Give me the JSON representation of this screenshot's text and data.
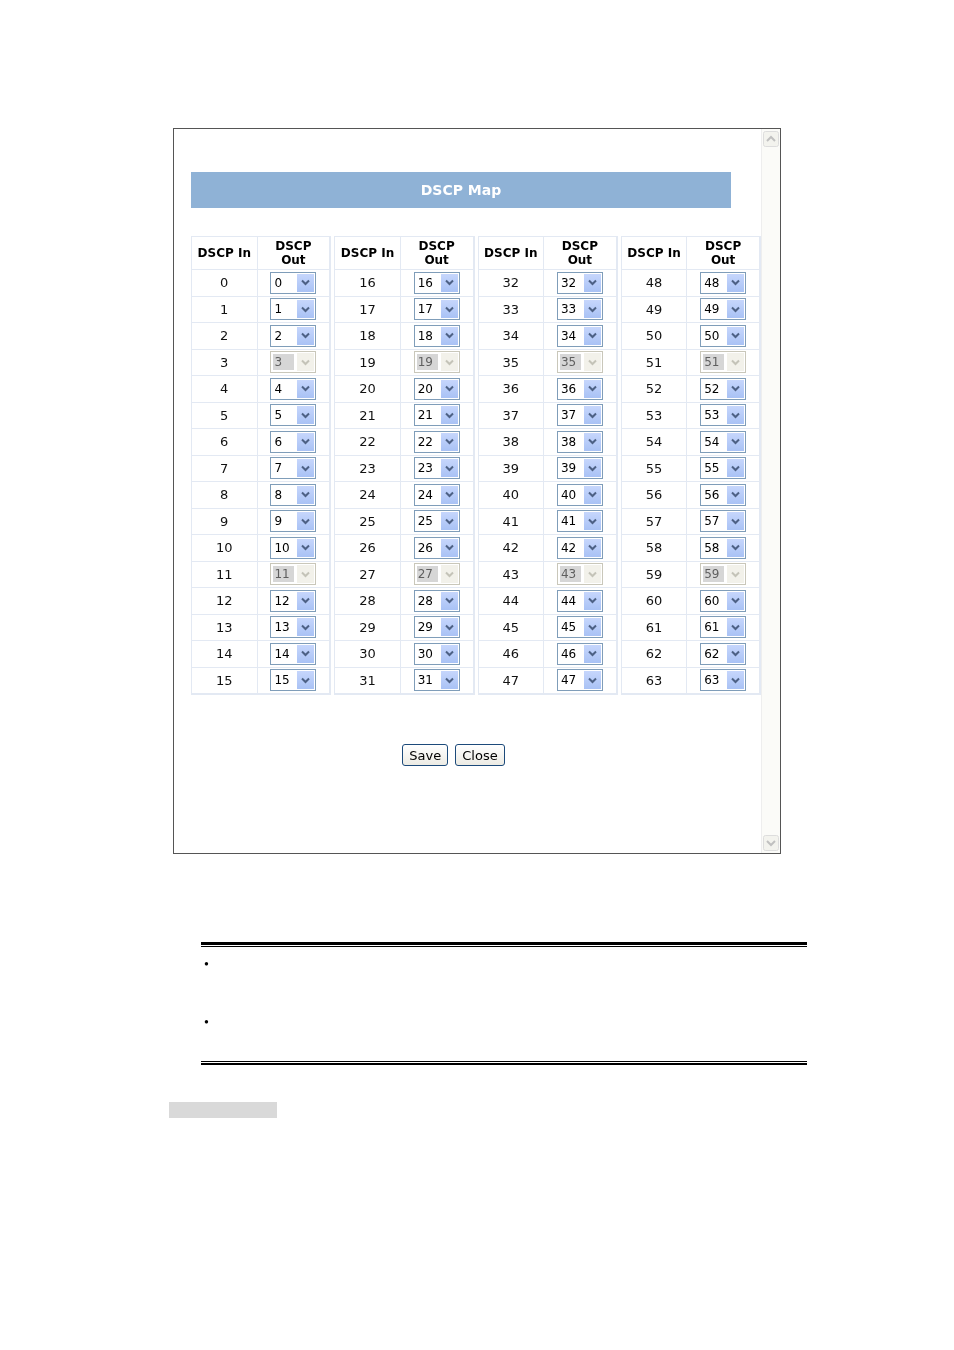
{
  "window": {
    "title": "DSCP Map",
    "groups": [
      {
        "columns": [
          "DSCP In",
          "DSCP Out"
        ],
        "rows": [
          {
            "in": "0",
            "out": "0",
            "disabled": false
          },
          {
            "in": "1",
            "out": "1",
            "disabled": false
          },
          {
            "in": "2",
            "out": "2",
            "disabled": false
          },
          {
            "in": "3",
            "out": "3",
            "disabled": true
          },
          {
            "in": "4",
            "out": "4",
            "disabled": false
          },
          {
            "in": "5",
            "out": "5",
            "disabled": false
          },
          {
            "in": "6",
            "out": "6",
            "disabled": false
          },
          {
            "in": "7",
            "out": "7",
            "disabled": false
          },
          {
            "in": "8",
            "out": "8",
            "disabled": false
          },
          {
            "in": "9",
            "out": "9",
            "disabled": false
          },
          {
            "in": "10",
            "out": "10",
            "disabled": false
          },
          {
            "in": "11",
            "out": "11",
            "disabled": true
          },
          {
            "in": "12",
            "out": "12",
            "disabled": false
          },
          {
            "in": "13",
            "out": "13",
            "disabled": false
          },
          {
            "in": "14",
            "out": "14",
            "disabled": false
          },
          {
            "in": "15",
            "out": "15",
            "disabled": false
          }
        ]
      },
      {
        "columns": [
          "DSCP In",
          "DSCP Out"
        ],
        "rows": [
          {
            "in": "16",
            "out": "16",
            "disabled": false
          },
          {
            "in": "17",
            "out": "17",
            "disabled": false
          },
          {
            "in": "18",
            "out": "18",
            "disabled": false
          },
          {
            "in": "19",
            "out": "19",
            "disabled": true
          },
          {
            "in": "20",
            "out": "20",
            "disabled": false
          },
          {
            "in": "21",
            "out": "21",
            "disabled": false
          },
          {
            "in": "22",
            "out": "22",
            "disabled": false
          },
          {
            "in": "23",
            "out": "23",
            "disabled": false
          },
          {
            "in": "24",
            "out": "24",
            "disabled": false
          },
          {
            "in": "25",
            "out": "25",
            "disabled": false
          },
          {
            "in": "26",
            "out": "26",
            "disabled": false
          },
          {
            "in": "27",
            "out": "27",
            "disabled": true
          },
          {
            "in": "28",
            "out": "28",
            "disabled": false
          },
          {
            "in": "29",
            "out": "29",
            "disabled": false
          },
          {
            "in": "30",
            "out": "30",
            "disabled": false
          },
          {
            "in": "31",
            "out": "31",
            "disabled": false
          }
        ]
      },
      {
        "columns": [
          "DSCP In",
          "DSCP Out"
        ],
        "rows": [
          {
            "in": "32",
            "out": "32",
            "disabled": false
          },
          {
            "in": "33",
            "out": "33",
            "disabled": false
          },
          {
            "in": "34",
            "out": "34",
            "disabled": false
          },
          {
            "in": "35",
            "out": "35",
            "disabled": true
          },
          {
            "in": "36",
            "out": "36",
            "disabled": false
          },
          {
            "in": "37",
            "out": "37",
            "disabled": false
          },
          {
            "in": "38",
            "out": "38",
            "disabled": false
          },
          {
            "in": "39",
            "out": "39",
            "disabled": false
          },
          {
            "in": "40",
            "out": "40",
            "disabled": false
          },
          {
            "in": "41",
            "out": "41",
            "disabled": false
          },
          {
            "in": "42",
            "out": "42",
            "disabled": false
          },
          {
            "in": "43",
            "out": "43",
            "disabled": true
          },
          {
            "in": "44",
            "out": "44",
            "disabled": false
          },
          {
            "in": "45",
            "out": "45",
            "disabled": false
          },
          {
            "in": "46",
            "out": "46",
            "disabled": false
          },
          {
            "in": "47",
            "out": "47",
            "disabled": false
          }
        ]
      },
      {
        "columns": [
          "DSCP In",
          "DSCP Out"
        ],
        "rows": [
          {
            "in": "48",
            "out": "48",
            "disabled": false
          },
          {
            "in": "49",
            "out": "49",
            "disabled": false
          },
          {
            "in": "50",
            "out": "50",
            "disabled": false
          },
          {
            "in": "51",
            "out": "51",
            "disabled": true
          },
          {
            "in": "52",
            "out": "52",
            "disabled": false
          },
          {
            "in": "53",
            "out": "53",
            "disabled": false
          },
          {
            "in": "54",
            "out": "54",
            "disabled": false
          },
          {
            "in": "55",
            "out": "55",
            "disabled": false
          },
          {
            "in": "56",
            "out": "56",
            "disabled": false
          },
          {
            "in": "57",
            "out": "57",
            "disabled": false
          },
          {
            "in": "58",
            "out": "58",
            "disabled": false
          },
          {
            "in": "59",
            "out": "59",
            "disabled": true
          },
          {
            "in": "60",
            "out": "60",
            "disabled": false
          },
          {
            "in": "61",
            "out": "61",
            "disabled": false
          },
          {
            "in": "62",
            "out": "62",
            "disabled": false
          },
          {
            "in": "63",
            "out": "63",
            "disabled": false
          }
        ]
      }
    ],
    "buttons": [
      "Save",
      "Close"
    ]
  },
  "notes": [
    {
      "bullet": "•"
    },
    {
      "bullet": "•"
    }
  ]
}
